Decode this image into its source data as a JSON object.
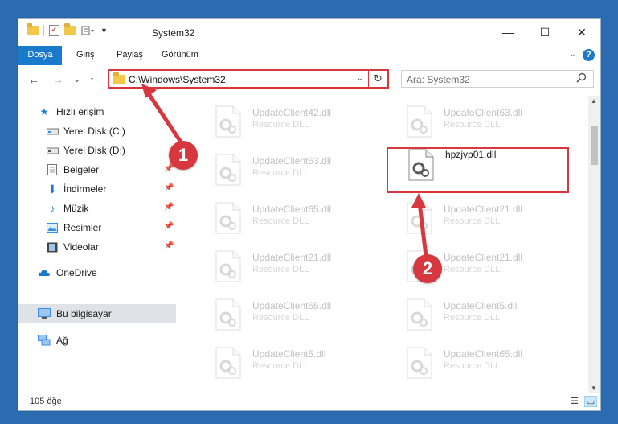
{
  "window": {
    "title": "System32",
    "caption": {
      "minimize": "—",
      "maximize": "☐",
      "close": "✕"
    }
  },
  "ribbon": {
    "tabs": [
      "Dosya",
      "Giriş",
      "Paylaş",
      "Görünüm"
    ],
    "help": "?"
  },
  "nav": {
    "back": "←",
    "forward": "→",
    "recent": "⌄",
    "up": "↑",
    "address": "C:\\Windows\\System32",
    "search_placeholder": "Ara: System32"
  },
  "sidebar": {
    "items": [
      {
        "label": "Hızlı erişim",
        "icon": "star-icon"
      },
      {
        "label": "Yerel Disk (C:)",
        "icon": "drive-icon"
      },
      {
        "label": "Yerel Disk (D:)",
        "icon": "drive-icon"
      },
      {
        "label": "Belgeler",
        "icon": "documents-icon"
      },
      {
        "label": "İndirmeler",
        "icon": "download-icon"
      },
      {
        "label": "Müzik",
        "icon": "music-icon"
      },
      {
        "label": "Resimler",
        "icon": "pictures-icon"
      },
      {
        "label": "Videolar",
        "icon": "video-icon"
      },
      {
        "label": "OneDrive",
        "icon": "cloud-icon"
      },
      {
        "label": "Bu bilgisayar",
        "icon": "computer-icon"
      },
      {
        "label": "Ağ",
        "icon": "network-icon"
      }
    ]
  },
  "files": [
    {
      "name": "UpdateClient42.dll",
      "type": "Resource DLL"
    },
    {
      "name": "UpdateClient63.dll",
      "type": "Resource DLL"
    },
    {
      "name": "UpdateClient63.dll",
      "type": "Resource DLL"
    },
    {
      "name": "hpzjvp01.dll",
      "type": ""
    },
    {
      "name": "UpdateClient65.dll",
      "type": "Resource DLL"
    },
    {
      "name": "UpdateClient21.dll",
      "type": "Resource DLL"
    },
    {
      "name": "UpdateClient21.dll",
      "type": "Resource DLL"
    },
    {
      "name": "UpdateClient21.dll",
      "type": "Resource DLL"
    },
    {
      "name": "UpdateClient65.dll",
      "type": "Resource DLL"
    },
    {
      "name": "UpdateClient5.dll",
      "type": "Resource DLL"
    },
    {
      "name": "UpdateClient5.dll",
      "type": "Resource DLL"
    },
    {
      "name": "UpdateClient65.dll",
      "type": "Resource DLL"
    }
  ],
  "status": {
    "count": "105 öğe"
  },
  "callouts": [
    "1",
    "2"
  ],
  "colors": {
    "accent": "#1979ca",
    "highlight": "#d7373f"
  }
}
